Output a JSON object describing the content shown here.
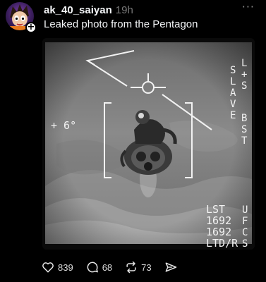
{
  "post": {
    "username": "ak_40_saiyan",
    "timestamp": "19h",
    "text": "Leaked photo from the Pentagon"
  },
  "media": {
    "hud": {
      "angle": "+ 6°",
      "mode": "SLAVE",
      "right_edge": [
        "L",
        "+",
        "S"
      ],
      "right_edge_2": [
        "B",
        "S",
        "T"
      ],
      "lst": "LST",
      "line1": "1692",
      "line2": "1692",
      "ltd": "LTD/R",
      "edge_letters": [
        "U",
        "F",
        "C",
        "S"
      ]
    }
  },
  "actions": {
    "likes": "839",
    "comments": "68",
    "reposts": "73"
  },
  "icons": [
    "more-icon",
    "heart-icon",
    "comment-icon",
    "repost-icon",
    "share-icon",
    "add-icon"
  ]
}
